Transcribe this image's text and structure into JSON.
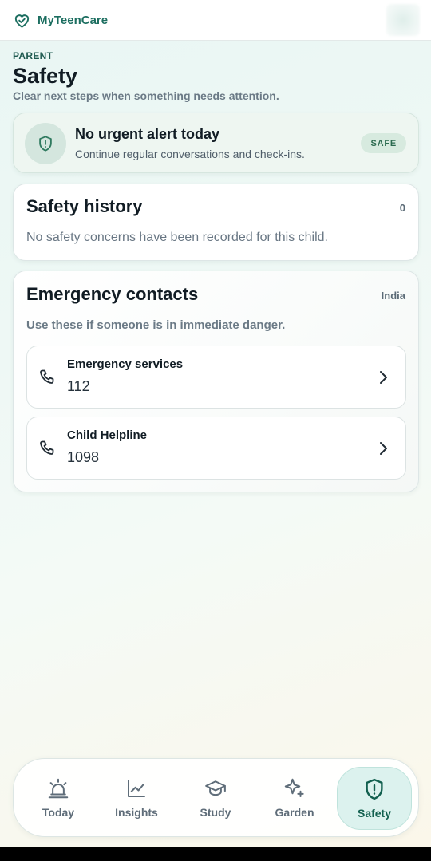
{
  "app": {
    "name": "MyTeenCare"
  },
  "header": {
    "eyebrow": "PARENT",
    "title": "Safety",
    "subtitle": "Clear next steps when something needs attention."
  },
  "status": {
    "title": "No urgent alert today",
    "text": "Continue regular conversations and check-ins.",
    "badge": "SAFE",
    "icon": "shield-icon"
  },
  "history": {
    "title": "Safety history",
    "count": "0",
    "empty_text": "No safety concerns have been recorded for this child."
  },
  "contacts": {
    "title": "Emergency contacts",
    "region": "India",
    "note": "Use these if someone is in immediate danger.",
    "items": [
      {
        "name": "Emergency services",
        "number": "112",
        "icon": "phone-icon"
      },
      {
        "name": "Child Helpline",
        "number": "1098",
        "icon": "phone-icon"
      }
    ]
  },
  "tabs": [
    {
      "label": "Today",
      "icon": "alarm-bell-icon",
      "active": false
    },
    {
      "label": "Insights",
      "icon": "trend-chart-icon",
      "active": false
    },
    {
      "label": "Study",
      "icon": "graduation-cap-icon",
      "active": false
    },
    {
      "label": "Garden",
      "icon": "sparkle-icon",
      "active": false
    },
    {
      "label": "Safety",
      "icon": "shield-alert-icon",
      "active": true
    }
  ],
  "colors": {
    "brand": "#1c6e60",
    "safe_badge_bg": "#d7eadf",
    "active_tab_bg": "#dcf2ee"
  }
}
